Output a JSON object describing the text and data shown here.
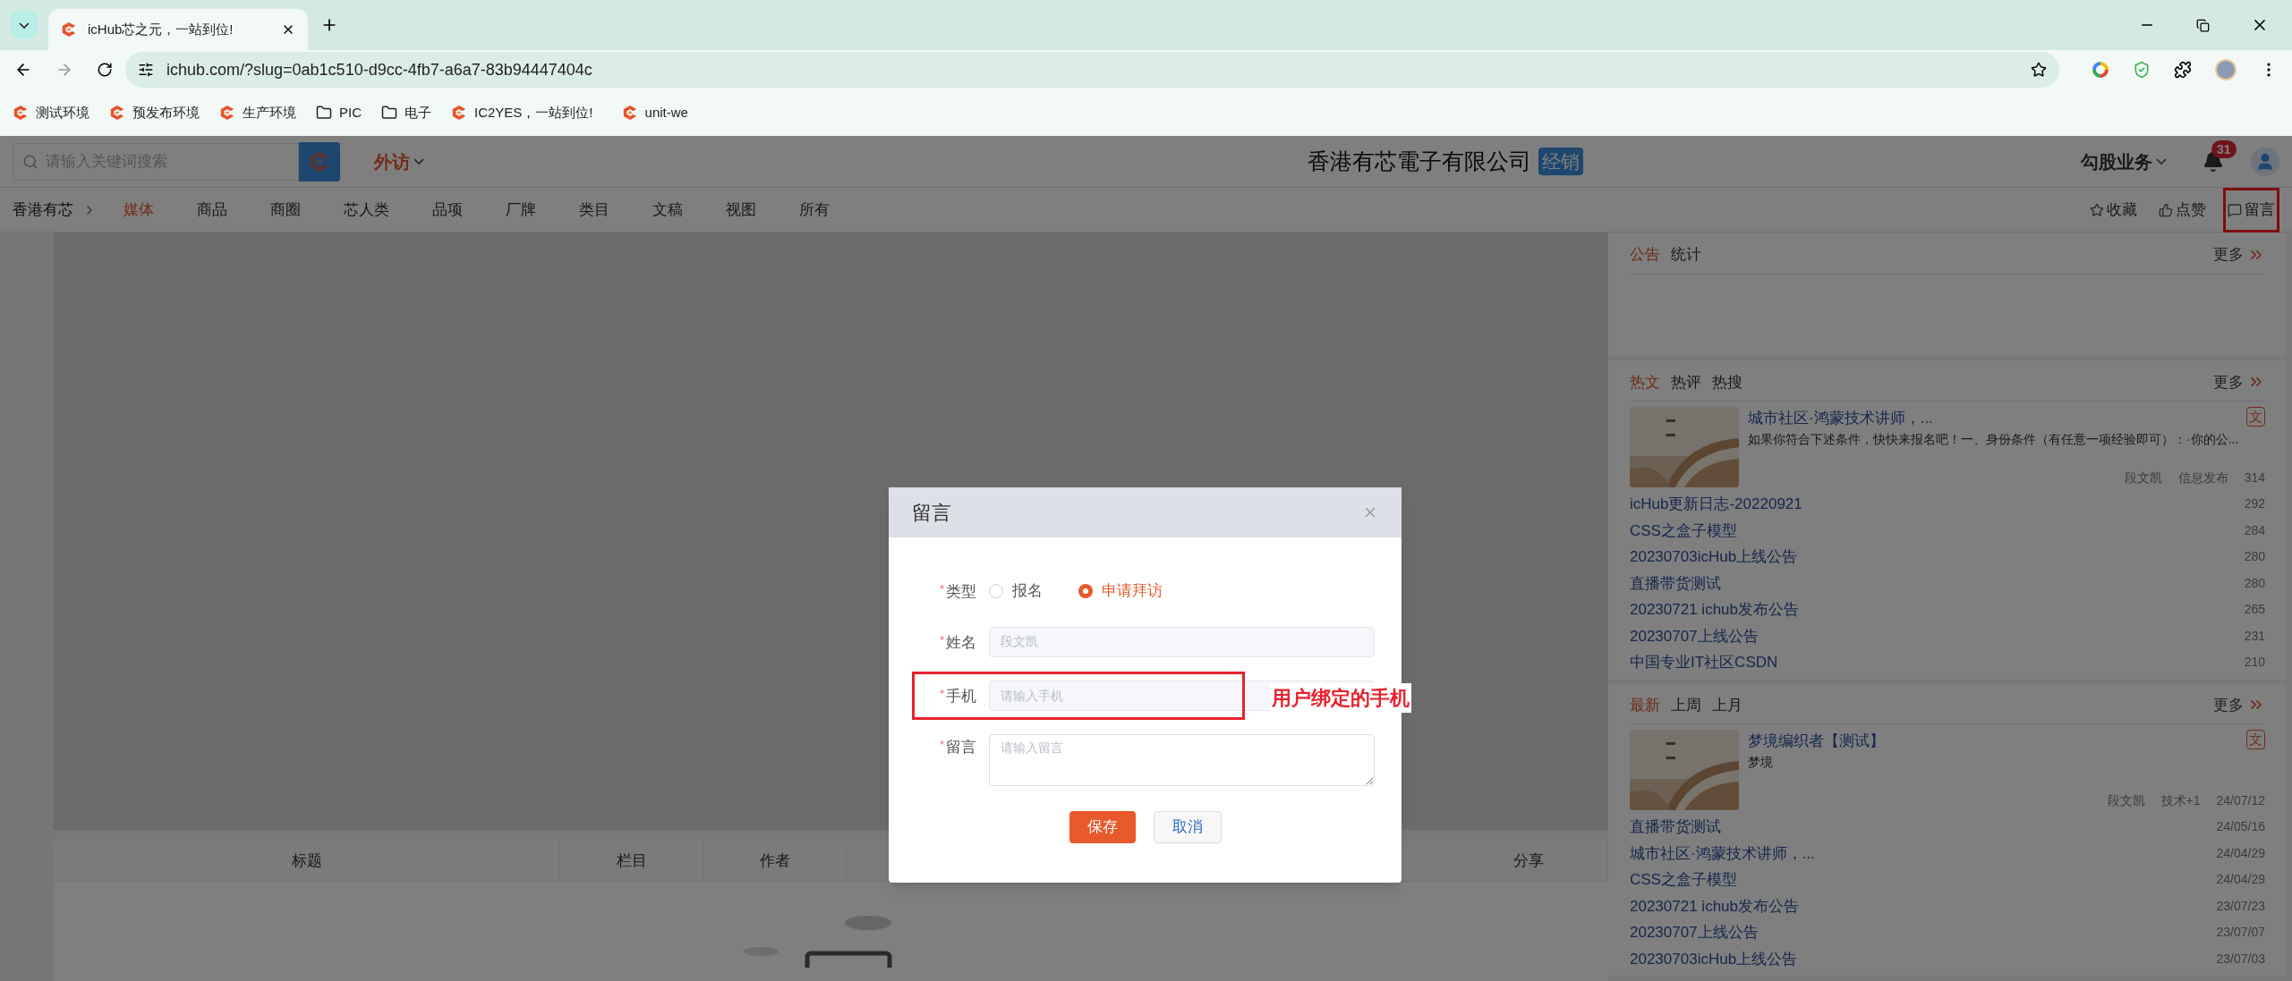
{
  "browser": {
    "tabs": [
      {
        "title": "icHub芯之元，一站到位!",
        "selected": true
      }
    ],
    "url": "ichub.com/?slug=0ab1c510-d9cc-4fb7-a6a7-83b94447404c",
    "bookmarks": [
      {
        "label": "测试环境",
        "kind": "site"
      },
      {
        "label": "预发布环境",
        "kind": "site"
      },
      {
        "label": "生产环境",
        "kind": "site"
      },
      {
        "label": "PIC",
        "kind": "folder"
      },
      {
        "label": "电子",
        "kind": "folder"
      },
      {
        "label": "IC2YES，一站到位!",
        "kind": "site"
      },
      {
        "label": "unit-we",
        "kind": "site"
      }
    ]
  },
  "header": {
    "search": {
      "placeholder": "请输入关键词搜索"
    },
    "menu": "外访",
    "company": "香港有芯電子有限公司",
    "company_badge": "经销",
    "business": "勾股业务",
    "notifications": "31"
  },
  "nav": {
    "breadcrumb": "香港有芯",
    "items": [
      {
        "label": "媒体",
        "selected": true
      },
      {
        "label": "商品",
        "selected": false
      },
      {
        "label": "商圈",
        "selected": false
      },
      {
        "label": "芯人类",
        "selected": false
      },
      {
        "label": "品项",
        "selected": false
      },
      {
        "label": "厂牌",
        "selected": false
      },
      {
        "label": "类目",
        "selected": false
      },
      {
        "label": "文稿",
        "selected": false
      },
      {
        "label": "视图",
        "selected": false
      },
      {
        "label": "所有",
        "selected": false
      }
    ],
    "actions": [
      {
        "label": "收藏",
        "kind": "star",
        "highlighted": false
      },
      {
        "label": "点赞",
        "kind": "like",
        "highlighted": false
      },
      {
        "label": "留言",
        "kind": "comment",
        "highlighted": true
      }
    ]
  },
  "table": {
    "columns": [
      "标题",
      "栏目",
      "作者",
      "分享"
    ]
  },
  "sidebar": [
    {
      "tabs": [
        {
          "label": "公告",
          "selected": true
        },
        {
          "label": "统计",
          "selected": false
        }
      ],
      "more": "更多"
    },
    {
      "tabs": [
        {
          "label": "热文",
          "selected": true
        },
        {
          "label": "热评",
          "selected": false
        },
        {
          "label": "热搜",
          "selected": false
        }
      ],
      "more": "更多",
      "featured": {
        "title": "城市社区·鸿蒙技术讲师，...",
        "summary": "如果你符合下述条件，快快来报名吧！一、身份条件（有任意一项经验即可）：·你的公...",
        "badge": "文",
        "meta": [
          "段文凯",
          "信息发布",
          "314"
        ]
      },
      "list": [
        {
          "title": "icHub更新日志-20220921",
          "value": "292"
        },
        {
          "title": "CSS之盒子模型",
          "value": "284"
        },
        {
          "title": "20230703icHub上线公告",
          "value": "280"
        },
        {
          "title": "直播带货测试",
          "value": "280"
        },
        {
          "title": "20230721 ichub发布公告",
          "value": "265"
        },
        {
          "title": "20230707上线公告",
          "value": "231"
        },
        {
          "title": "中国专业IT社区CSDN",
          "value": "210"
        }
      ]
    },
    {
      "tabs": [
        {
          "label": "最新",
          "selected": true
        },
        {
          "label": "上周",
          "selected": false
        },
        {
          "label": "上月",
          "selected": false
        }
      ],
      "more": "更多",
      "featured": {
        "title": "梦境编织者【测试】",
        "summary": "梦境",
        "badge": "文",
        "meta": [
          "段文凯",
          "技术+1",
          "24/07/12"
        ]
      },
      "list": [
        {
          "title": "直播带货测试",
          "value": "24/05/16"
        },
        {
          "title": "城市社区·鸿蒙技术讲师，...",
          "value": "24/04/29"
        },
        {
          "title": "CSS之盒子模型",
          "value": "24/04/29"
        },
        {
          "title": "20230721 ichub发布公告",
          "value": "23/07/23"
        },
        {
          "title": "20230707上线公告",
          "value": "23/07/07"
        },
        {
          "title": "20230703icHub上线公告",
          "value": "23/07/03"
        }
      ]
    }
  ],
  "modal": {
    "title": "留言",
    "fields": [
      {
        "kind": "radio",
        "label": "类型",
        "required": true,
        "options": [
          {
            "label": "报名",
            "selected": false
          },
          {
            "label": "申请拜访",
            "selected": true
          }
        ]
      },
      {
        "kind": "input",
        "label": "姓名",
        "required": true,
        "value": "段文凯",
        "disabled": true,
        "annotated": false
      },
      {
        "kind": "input",
        "label": "手机",
        "required": true,
        "placeholder": "请输入手机",
        "disabled": true,
        "annotated": true
      },
      {
        "kind": "textarea",
        "label": "留言",
        "required": true,
        "placeholder": "请输入留言"
      }
    ],
    "buttons": [
      {
        "label": "保存",
        "kind": "primary"
      },
      {
        "label": "取消",
        "kind": "secondary"
      }
    ],
    "annotation": "用户绑定的手机",
    "required_mark": "*"
  }
}
